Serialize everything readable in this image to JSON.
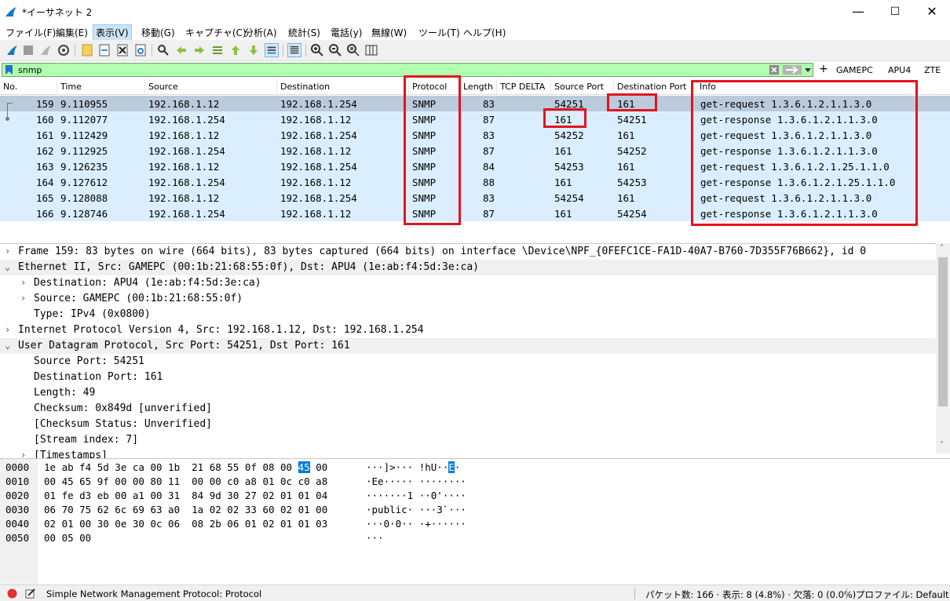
{
  "window": {
    "title": "*イーサネット 2",
    "minimize": "—",
    "maximize": "☐",
    "close": "✕"
  },
  "menu": [
    "ファイル(F)",
    "編集(E)",
    "表示(V)",
    "移動(G)",
    "キャプチャ(C)",
    "分析(A)",
    "統計(S)",
    "電話(y)",
    "無線(W)",
    "ツール(T)",
    "ヘルプ(H)"
  ],
  "filter": {
    "value": "snmp",
    "buttons": [
      "GAMEPC",
      "APU4",
      "ZTE"
    ],
    "plus": "+"
  },
  "columns": [
    "No.",
    "Time",
    "Source",
    "Destination",
    "Protocol",
    "Length",
    "TCP DELTA",
    "Source Port",
    "Destination Port",
    "Info"
  ],
  "packets": [
    {
      "no": "159",
      "time": "9.110955",
      "src": "192.168.1.12",
      "dst": "192.168.1.254",
      "proto": "SNMP",
      "len": "83",
      "sport": "54251",
      "dport": "161",
      "info": "get-request 1.3.6.1.2.1.1.3.0"
    },
    {
      "no": "160",
      "time": "9.112077",
      "src": "192.168.1.254",
      "dst": "192.168.1.12",
      "proto": "SNMP",
      "len": "87",
      "sport": "161",
      "dport": "54251",
      "info": "get-response 1.3.6.1.2.1.1.3.0"
    },
    {
      "no": "161",
      "time": "9.112429",
      "src": "192.168.1.12",
      "dst": "192.168.1.254",
      "proto": "SNMP",
      "len": "83",
      "sport": "54252",
      "dport": "161",
      "info": "get-request 1.3.6.1.2.1.1.3.0"
    },
    {
      "no": "162",
      "time": "9.112925",
      "src": "192.168.1.254",
      "dst": "192.168.1.12",
      "proto": "SNMP",
      "len": "87",
      "sport": "161",
      "dport": "54252",
      "info": "get-response 1.3.6.1.2.1.1.3.0"
    },
    {
      "no": "163",
      "time": "9.126235",
      "src": "192.168.1.12",
      "dst": "192.168.1.254",
      "proto": "SNMP",
      "len": "84",
      "sport": "54253",
      "dport": "161",
      "info": "get-request 1.3.6.1.2.1.25.1.1.0"
    },
    {
      "no": "164",
      "time": "9.127612",
      "src": "192.168.1.254",
      "dst": "192.168.1.12",
      "proto": "SNMP",
      "len": "88",
      "sport": "161",
      "dport": "54253",
      "info": "get-response 1.3.6.1.2.1.25.1.1.0"
    },
    {
      "no": "165",
      "time": "9.128088",
      "src": "192.168.1.12",
      "dst": "192.168.1.254",
      "proto": "SNMP",
      "len": "83",
      "sport": "54254",
      "dport": "161",
      "info": "get-request 1.3.6.1.2.1.1.3.0"
    },
    {
      "no": "166",
      "time": "9.128746",
      "src": "192.168.1.254",
      "dst": "192.168.1.12",
      "proto": "SNMP",
      "len": "87",
      "sport": "161",
      "dport": "54254",
      "info": "get-response 1.3.6.1.2.1.1.3.0"
    }
  ],
  "tree": [
    {
      "text": "Frame 159: 83 bytes on wire (664 bits), 83 bytes captured (664 bits) on interface \\Device\\NPF_{0FEFC1CE-FA1D-40A7-B760-7D355F76B662}, id 0",
      "arrow": "›"
    },
    {
      "text": "Ethernet II, Src: GAMEPC (00:1b:21:68:55:0f), Dst: APU4 (1e:ab:f4:5d:3e:ca)",
      "arrow": "⌄"
    },
    {
      "text": "Destination: APU4 (1e:ab:f4:5d:3e:ca)",
      "arrow": "›"
    },
    {
      "text": "Source: GAMEPC (00:1b:21:68:55:0f)",
      "arrow": "›"
    },
    {
      "text": "Type: IPv4 (0x0800)",
      "arrow": ""
    },
    {
      "text": "Internet Protocol Version 4, Src: 192.168.1.12, Dst: 192.168.1.254",
      "arrow": "›"
    },
    {
      "text": "User Datagram Protocol, Src Port: 54251, Dst Port: 161",
      "arrow": "⌄"
    },
    {
      "text": "Source Port: 54251",
      "arrow": ""
    },
    {
      "text": "Destination Port: 161",
      "arrow": ""
    },
    {
      "text": "Length: 49",
      "arrow": ""
    },
    {
      "text": "Checksum: 0x849d [unverified]",
      "arrow": ""
    },
    {
      "text": "[Checksum Status: Unverified]",
      "arrow": ""
    },
    {
      "text": "[Stream index: 7]",
      "arrow": ""
    },
    {
      "text": "[Timestamps]",
      "arrow": "›"
    }
  ],
  "hex": [
    {
      "off": "0000",
      "pre": "1e ab f4 5d 3e ca 00 1b  21 68 55 0f 08 00 ",
      "sel": "45",
      "post": " 00",
      "apre": "···]>··· !hU··",
      "asel": "E",
      "apost": "·"
    },
    {
      "off": "0010",
      "pre": "00 45 65 9f 00 00 80 11  00 00 c0 a8 01 0c c0 a8",
      "sel": "",
      "post": "",
      "apre": "·Ee····· ········",
      "asel": "",
      "apost": ""
    },
    {
      "off": "0020",
      "pre": "01 fe d3 eb 00 a1 00 31  84 9d 30 27 02 01 01 04",
      "sel": "",
      "post": "",
      "apre": "·······1 ··0'····",
      "asel": "",
      "apost": ""
    },
    {
      "off": "0030",
      "pre": "06 70 75 62 6c 69 63 a0  1a 02 02 33 60 02 01 00",
      "sel": "",
      "post": "",
      "apre": "·public· ···3`···",
      "asel": "",
      "apost": ""
    },
    {
      "off": "0040",
      "pre": "02 01 00 30 0e 30 0c 06  08 2b 06 01 02 01 01 03",
      "sel": "",
      "post": "",
      "apre": "···0·0·· ·+······",
      "asel": "",
      "apost": ""
    },
    {
      "off": "0050",
      "pre": "00 05 00",
      "sel": "",
      "post": "",
      "apre": "···",
      "asel": "",
      "apost": ""
    }
  ],
  "status": {
    "protocol": "Simple Network Management Protocol: Protocol",
    "packets": "パケット数: 166 · 表示: 8 (4.8%) · 欠落: 0 (0.0%)",
    "profile": "プロファイル: Default"
  },
  "colors": {
    "row_bg": "#daeeff",
    "row_selected": "#bccbdc",
    "filter_ok": "#afffaf",
    "highlight": "#e3141e"
  }
}
